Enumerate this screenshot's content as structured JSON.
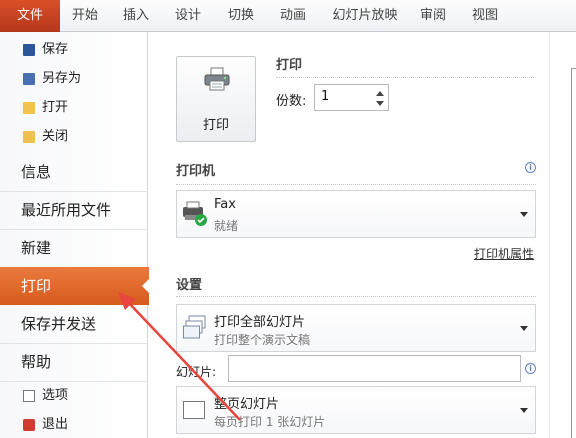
{
  "ribbon": {
    "tabs": [
      {
        "label": "文件",
        "active": true
      },
      {
        "label": "开始"
      },
      {
        "label": "插入"
      },
      {
        "label": "设计"
      },
      {
        "label": "切换"
      },
      {
        "label": "动画"
      },
      {
        "label": "幻灯片放映"
      },
      {
        "label": "审阅"
      },
      {
        "label": "视图"
      }
    ]
  },
  "nav": {
    "save": "保存",
    "save_as": "另存为",
    "open": "打开",
    "close": "关闭",
    "info": "信息",
    "recent": "最近所用文件",
    "new": "新建",
    "print": "打印",
    "save_send": "保存并发送",
    "help": "帮助",
    "options": "选项",
    "exit": "退出"
  },
  "print": {
    "button_label": "打印",
    "heading": "打印",
    "copies_label": "份数:",
    "copies_value": "1"
  },
  "printer": {
    "heading": "打印机",
    "name": "Fax",
    "status": "就绪",
    "properties_link": "打印机属性"
  },
  "settings": {
    "heading": "设置",
    "range": {
      "title": "打印全部幻灯片",
      "subtitle": "打印整个演示文稿"
    },
    "slides_label": "幻灯片:",
    "slides_value": "",
    "layout": {
      "title": "整页幻灯片",
      "subtitle": "每页打印 1 张幻灯片"
    }
  },
  "colors": {
    "accent": "#d75a1e",
    "file_tab": "#c0421f",
    "annotation_arrow": "#e8453c"
  }
}
